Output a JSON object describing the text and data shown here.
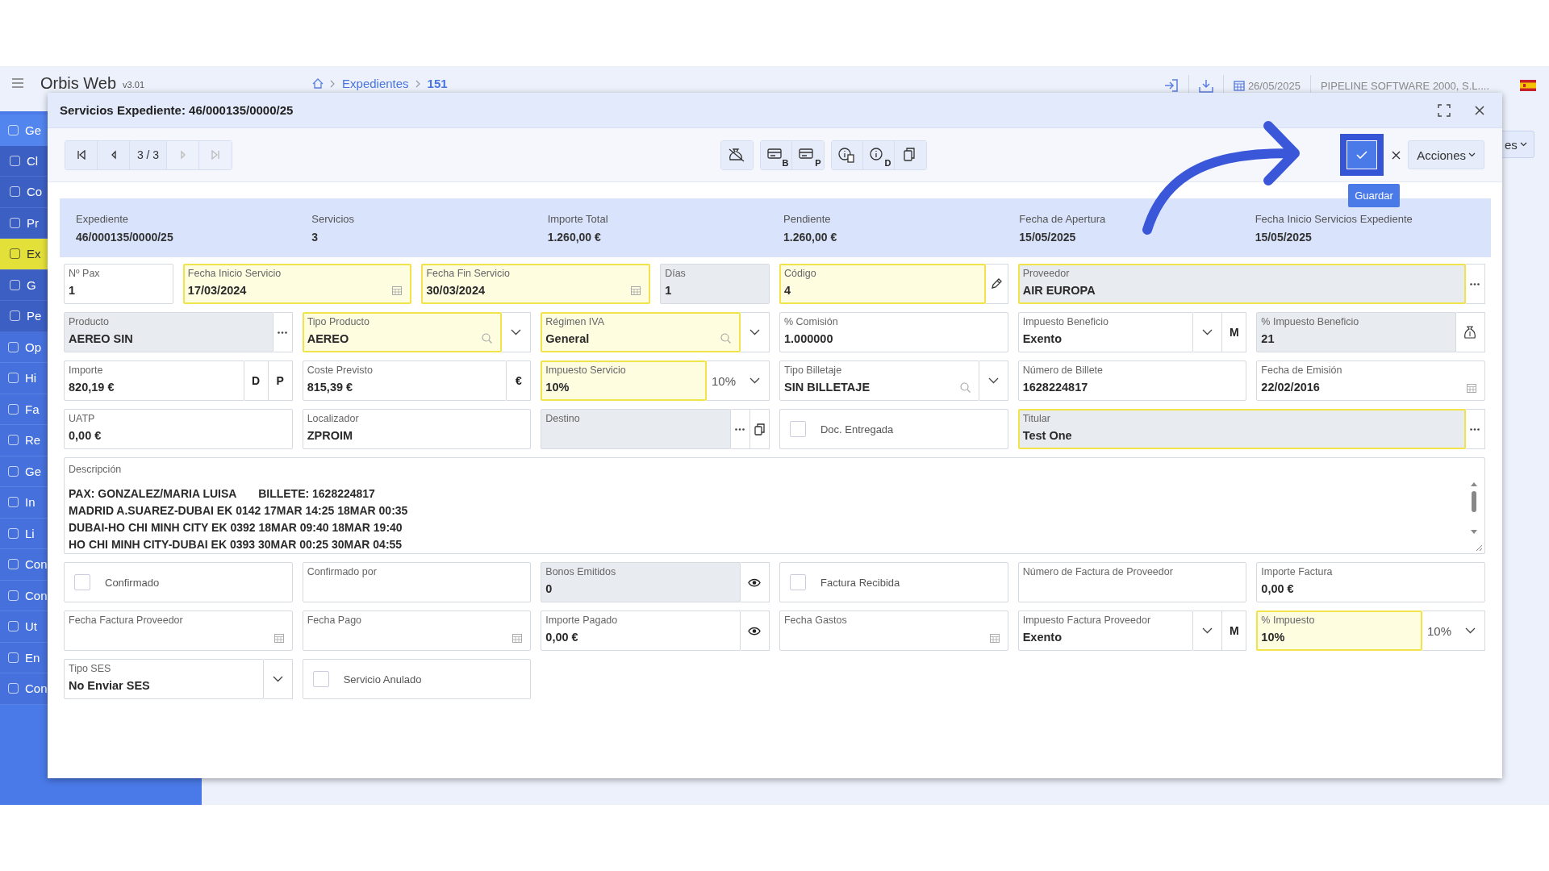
{
  "app": {
    "name": "Orbis Web",
    "version": "v3.01"
  },
  "breadcrumb": [
    "Expedientes",
    "151"
  ],
  "topbar": {
    "date": "26/05/2025",
    "company": "PIPELINE SOFTWARE 2000, S.L...."
  },
  "sidebar": [
    {
      "kind": "group",
      "label": "Ge",
      "selected": false
    },
    {
      "kind": "sub",
      "label": "Cl",
      "selected": false
    },
    {
      "kind": "sub",
      "label": "Co",
      "selected": false
    },
    {
      "kind": "sub",
      "label": "Pr",
      "selected": false
    },
    {
      "kind": "sub",
      "label": "Ex",
      "selected": true
    },
    {
      "kind": "sub",
      "label": "G",
      "selected": false
    },
    {
      "kind": "sub",
      "label": "Pe",
      "selected": false
    },
    {
      "kind": "item",
      "label": "Op",
      "selected": false
    },
    {
      "kind": "item",
      "label": "Hi",
      "selected": false
    },
    {
      "kind": "item",
      "label": "Fa",
      "selected": false
    },
    {
      "kind": "item",
      "label": "Re",
      "selected": false
    },
    {
      "kind": "item",
      "label": "Ge",
      "selected": false
    },
    {
      "kind": "item",
      "label": "In",
      "selected": false
    },
    {
      "kind": "item",
      "label": "Li",
      "selected": false
    },
    {
      "kind": "item",
      "label": "Con",
      "selected": false
    },
    {
      "kind": "item",
      "label": "Con",
      "selected": false
    },
    {
      "kind": "item",
      "label": "Ut",
      "selected": false
    },
    {
      "kind": "item",
      "label": "En",
      "selected": false
    },
    {
      "kind": "item",
      "label": "Con",
      "selected": false
    }
  ],
  "background_button": "es",
  "modal": {
    "title": "Servicios Expediente: 46/000135/0000/25",
    "nav": [
      {
        "kind": "first",
        "disabled": false
      },
      {
        "kind": "prev",
        "disabled": false
      },
      {
        "kind": "counter",
        "text": "3 / 3"
      },
      {
        "kind": "next",
        "disabled": true
      },
      {
        "kind": "last",
        "disabled": true
      }
    ],
    "tool_groups": [
      [
        {
          "kind": "money-off"
        }
      ],
      [
        {
          "kind": "card",
          "letter": "B"
        },
        {
          "kind": "card-dollar",
          "letter": "P"
        }
      ],
      [
        {
          "kind": "info-doc"
        },
        {
          "kind": "info",
          "letter": "D"
        },
        {
          "kind": "copy"
        }
      ]
    ],
    "save": {
      "tooltip": "Guardar",
      "highlighted": true
    },
    "menu_label": "Acciones",
    "annotation": {
      "kind": "arrow"
    },
    "summary": [
      {
        "label": "Expediente",
        "value": "46/000135/0000/25"
      },
      {
        "label": "Servicios",
        "value": "3"
      },
      {
        "label": "Importe Total",
        "value": "1.260,00 €"
      },
      {
        "label": "Pendiente",
        "value": "1.260,00 €"
      },
      {
        "label": "Fecha de Apertura",
        "value": "15/05/2025"
      },
      {
        "label": "Fecha Inicio Servicios Expediente",
        "value": "15/05/2025"
      }
    ],
    "rows": [
      {
        "fields": [
          {
            "kind": "text",
            "label": "Nº Pax",
            "value": "1",
            "required": false,
            "readonly": false
          },
          {
            "kind": "date",
            "label": "Fecha Inicio Servicio",
            "value": "17/03/2024",
            "required": true,
            "readonly": false
          },
          {
            "kind": "date",
            "label": "Fecha Fin Servicio",
            "value": "30/03/2024",
            "required": true,
            "readonly": false
          },
          {
            "kind": "text",
            "label": "Días",
            "value": "1",
            "required": false,
            "readonly": true
          },
          {
            "kind": "text",
            "label": "Código",
            "value": "4",
            "required": true,
            "readonly": false,
            "buttons": [
              {
                "kind": "pencil"
              }
            ]
          },
          {
            "kind": "text",
            "label": "Proveedor",
            "value": "AIR EUROPA",
            "required": true,
            "readonly": true,
            "buttons": [
              {
                "kind": "dots"
              }
            ]
          }
        ]
      },
      {
        "fields": [
          {
            "kind": "text",
            "label": "Producto",
            "value": "AEREO SIN",
            "required": false,
            "readonly": true,
            "buttons": [
              {
                "kind": "dots"
              }
            ]
          },
          {
            "kind": "lookup",
            "label": "Tipo Producto",
            "value": "AEREO",
            "required": true,
            "readonly": false,
            "buttons": [
              {
                "kind": "chevron"
              }
            ]
          },
          {
            "kind": "lookup",
            "label": "Régimen IVA",
            "value": "General",
            "required": true,
            "readonly": false,
            "buttons": [
              {
                "kind": "chevron"
              }
            ]
          },
          {
            "kind": "text",
            "label": "% Comisión",
            "value": "1.000000",
            "required": false,
            "readonly": false
          },
          {
            "kind": "text",
            "label": "Impuesto Beneficio",
            "value": "Exento",
            "required": false,
            "readonly": false,
            "buttons": [
              {
                "kind": "chevron"
              },
              {
                "kind": "letter",
                "text": "M"
              }
            ]
          },
          {
            "kind": "text",
            "label": "% Impuesto Beneficio",
            "value": "21",
            "required": false,
            "readonly": true,
            "buttons": [
              {
                "kind": "bag"
              }
            ]
          }
        ]
      },
      {
        "fields": [
          {
            "kind": "text",
            "label": "Importe",
            "value": "820,19 €",
            "required": false,
            "readonly": false,
            "buttons": [
              {
                "kind": "letter",
                "text": "D"
              },
              {
                "kind": "letter",
                "text": "P"
              }
            ]
          },
          {
            "kind": "text",
            "label": "Coste Previsto",
            "value": "815,39 €",
            "required": false,
            "readonly": false,
            "buttons": [
              {
                "kind": "letter",
                "text": "€"
              }
            ]
          },
          {
            "kind": "text",
            "label": "Impuesto Servicio",
            "value": "10%",
            "required": true,
            "readonly": false,
            "buttons": [
              {
                "kind": "plain",
                "text": "10%"
              },
              {
                "kind": "chevron"
              }
            ]
          },
          {
            "kind": "lookup",
            "label": "Tipo Billetaje",
            "value": "SIN BILLETAJE",
            "required": false,
            "readonly": false,
            "buttons": [
              {
                "kind": "chevron"
              }
            ]
          },
          {
            "kind": "text",
            "label": "Número de Billete",
            "value": "1628224817",
            "required": false,
            "readonly": false
          },
          {
            "kind": "date",
            "label": "Fecha de Emisión",
            "value": "22/02/2016",
            "required": false,
            "readonly": false
          }
        ]
      },
      {
        "fields": [
          {
            "kind": "text",
            "label": "UATP",
            "value": "0,00 €",
            "required": false,
            "readonly": false
          },
          {
            "kind": "text",
            "label": "Localizador",
            "value": "ZPROIM",
            "required": false,
            "readonly": false
          },
          {
            "kind": "text",
            "label": "Destino",
            "required": false,
            "readonly": true,
            "buttons": [
              {
                "kind": "dots"
              },
              {
                "kind": "copy"
              }
            ]
          },
          {
            "kind": "checkbox",
            "label": "Doc. Entregada",
            "checked": false
          },
          {
            "kind": "text",
            "label": "Titular",
            "value": "Test One",
            "required": true,
            "readonly": true,
            "buttons": [
              {
                "kind": "dots"
              }
            ]
          }
        ]
      },
      {
        "fields": [
          {
            "kind": "textarea",
            "label": "Descripción",
            "lines": [
              "PAX: GONZALEZ/MARIA LUISA       BILLETE: 1628224817",
              "MADRID A.SUAREZ-DUBAI EK 0142 17MAR 14:25 18MAR 00:35",
              "DUBAI-HO CHI MINH CITY EK 0392 18MAR 09:40 18MAR 19:40",
              "HO CHI MINH CITY-DUBAI EK 0393 30MAR 00:25 30MAR 04:55"
            ]
          }
        ]
      },
      {
        "fields": [
          {
            "kind": "checkbox",
            "label": "Confirmado",
            "checked": false
          },
          {
            "kind": "text",
            "label": "Confirmado por",
            "required": false,
            "readonly": false
          },
          {
            "kind": "text",
            "label": "Bonos Emitidos",
            "value": "0",
            "required": false,
            "readonly": true,
            "buttons": [
              {
                "kind": "eye"
              }
            ]
          },
          {
            "kind": "checkbox",
            "label": "Factura Recibida",
            "checked": false
          },
          {
            "kind": "text",
            "label": "Número de Factura de Proveedor",
            "required": false,
            "readonly": false
          },
          {
            "kind": "text",
            "label": "Importe Factura",
            "value": "0,00 €",
            "required": false,
            "readonly": false
          }
        ]
      },
      {
        "fields": [
          {
            "kind": "date",
            "label": "Fecha Factura Proveedor",
            "required": false,
            "readonly": false
          },
          {
            "kind": "date",
            "label": "Fecha Pago",
            "required": false,
            "readonly": false
          },
          {
            "kind": "text",
            "label": "Importe Pagado",
            "value": "0,00 €",
            "required": false,
            "readonly": false,
            "buttons": [
              {
                "kind": "eye"
              }
            ]
          },
          {
            "kind": "date",
            "label": "Fecha Gastos",
            "required": false,
            "readonly": false
          },
          {
            "kind": "text",
            "label": "Impuesto Factura Proveedor",
            "value": "Exento",
            "required": false,
            "readonly": false,
            "buttons": [
              {
                "kind": "chevron"
              },
              {
                "kind": "letter",
                "text": "M"
              }
            ]
          },
          {
            "kind": "text",
            "label": "% Impuesto",
            "value": "10%",
            "required": true,
            "readonly": false,
            "buttons": [
              {
                "kind": "plain",
                "text": "10%"
              },
              {
                "kind": "chevron"
              }
            ]
          }
        ]
      },
      {
        "fields": [
          {
            "kind": "text",
            "label": "Tipo SES",
            "value": "No Enviar SES",
            "required": false,
            "readonly": false,
            "buttons": [
              {
                "kind": "chevron"
              }
            ]
          },
          {
            "kind": "checkbox",
            "label": "Servicio Anulado",
            "checked": false
          }
        ]
      }
    ]
  }
}
